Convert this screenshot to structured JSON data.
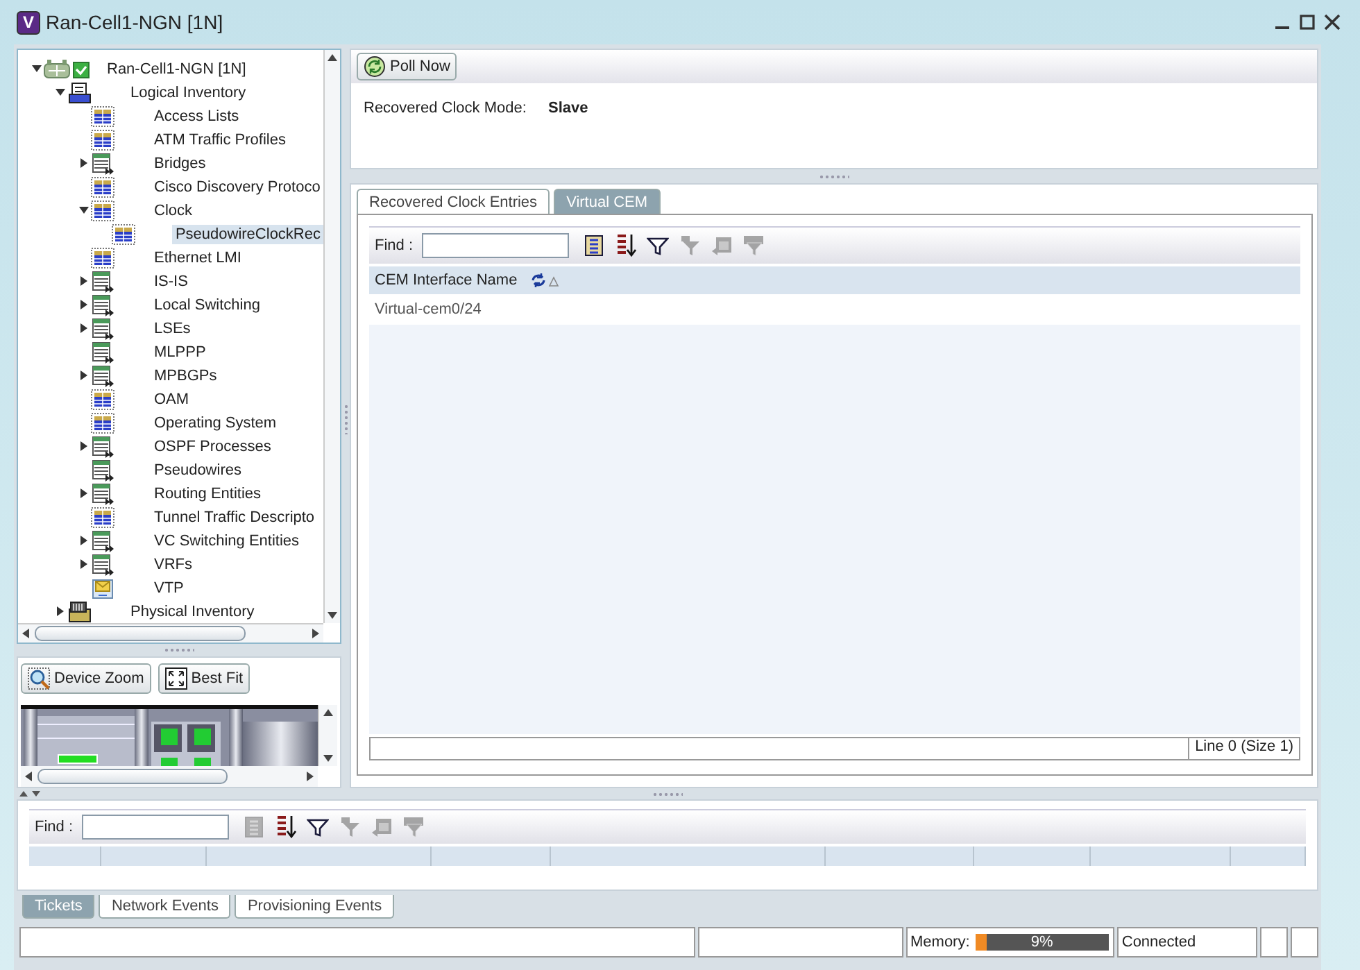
{
  "window": {
    "logo": "V",
    "title": "Ran-Cell1-NGN [1N]"
  },
  "tree": [
    {
      "label": "Ran-Cell1-NGN [1N]",
      "kind": "device",
      "expanded": true,
      "selected": false,
      "children": [
        {
          "label": "Logical Inventory",
          "kind": "inventory",
          "expanded": true,
          "selected": false,
          "children": [
            {
              "label": "Access Lists",
              "kind": "record",
              "selected": false
            },
            {
              "label": "ATM Traffic Profiles",
              "kind": "record",
              "selected": false
            },
            {
              "label": "Bridges",
              "kind": "list",
              "expanded": false,
              "selected": false
            },
            {
              "label": "Cisco Discovery Protoco",
              "kind": "record",
              "selected": false
            },
            {
              "label": "Clock",
              "kind": "record",
              "expanded": true,
              "selected": false,
              "children": [
                {
                  "label": "PseudowireClockRec",
                  "kind": "record",
                  "selected": true
                }
              ]
            },
            {
              "label": "Ethernet LMI",
              "kind": "record",
              "selected": false
            },
            {
              "label": "IS-IS",
              "kind": "list",
              "expanded": false,
              "selected": false
            },
            {
              "label": "Local Switching",
              "kind": "list",
              "expanded": false,
              "selected": false
            },
            {
              "label": "LSEs",
              "kind": "list",
              "expanded": false,
              "selected": false
            },
            {
              "label": "MLPPP",
              "kind": "list",
              "selected": false
            },
            {
              "label": "MPBGPs",
              "kind": "list",
              "expanded": false,
              "selected": false
            },
            {
              "label": "OAM",
              "kind": "record",
              "selected": false
            },
            {
              "label": "Operating System",
              "kind": "record",
              "selected": false
            },
            {
              "label": "OSPF Processes",
              "kind": "list",
              "expanded": false,
              "selected": false
            },
            {
              "label": "Pseudowires",
              "kind": "list",
              "selected": false
            },
            {
              "label": "Routing Entities",
              "kind": "list",
              "expanded": false,
              "selected": false
            },
            {
              "label": "Tunnel Traffic Descripto",
              "kind": "record",
              "selected": false
            },
            {
              "label": "VC Switching Entities",
              "kind": "list",
              "expanded": false,
              "selected": false
            },
            {
              "label": "VRFs",
              "kind": "list",
              "expanded": false,
              "selected": false
            },
            {
              "label": "VTP",
              "kind": "protocol",
              "selected": false
            }
          ]
        },
        {
          "label": "Physical Inventory",
          "kind": "hardware",
          "expanded": false,
          "selected": false
        }
      ]
    }
  ],
  "overview": {
    "buttons": [
      {
        "label": "Device Zoom",
        "kind": "zoom"
      },
      {
        "label": "Best Fit",
        "kind": "fit"
      }
    ]
  },
  "details": {
    "poll_button": "Poll Now",
    "fields": [
      {
        "label": "Recovered Clock Mode:",
        "value": "Slave"
      }
    ]
  },
  "tabs": [
    {
      "label": "Recovered Clock Entries",
      "selected": false
    },
    {
      "label": "Virtual CEM",
      "selected": true
    }
  ],
  "table": {
    "find_label": "Find :",
    "toolbar": [
      {
        "kind": "columns",
        "disabled": false
      },
      {
        "kind": "sort",
        "disabled": false
      },
      {
        "kind": "filter",
        "disabled": false
      },
      {
        "kind": "clear-filter",
        "disabled": true
      },
      {
        "kind": "export",
        "disabled": true
      },
      {
        "kind": "advanced-filter",
        "disabled": true
      }
    ],
    "columns": [
      "CEM Interface Name"
    ],
    "rows": [
      [
        "Virtual-cem0/24"
      ]
    ],
    "footer": "Line 0 (Size 1)"
  },
  "bottom": {
    "find_label": "Find :",
    "toolbar": [
      {
        "kind": "columns",
        "disabled": true
      },
      {
        "kind": "sort",
        "disabled": false
      },
      {
        "kind": "filter",
        "disabled": false
      },
      {
        "kind": "clear-filter",
        "disabled": true
      },
      {
        "kind": "export",
        "disabled": true
      },
      {
        "kind": "advanced-filter",
        "disabled": true
      }
    ],
    "tabs": [
      {
        "label": "Tickets",
        "selected": true
      },
      {
        "label": "Network Events",
        "selected": false
      },
      {
        "label": "Provisioning Events",
        "selected": false
      }
    ]
  },
  "status_bar": {
    "memory_label": "Memory:",
    "memory": {
      "level": 0.09,
      "reading": "9%"
    },
    "connection": "Connected"
  }
}
